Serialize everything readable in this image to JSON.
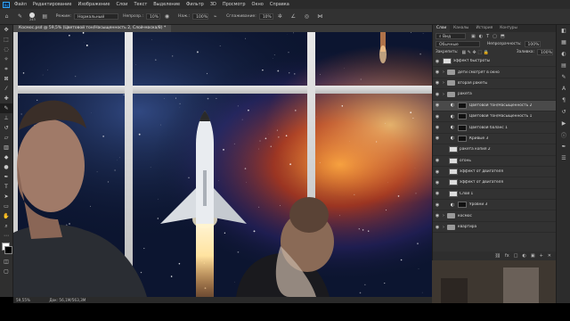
{
  "menu": {
    "logo": "Ps",
    "items": [
      "Файл",
      "Редактирование",
      "Изображение",
      "Слои",
      "Текст",
      "Выделение",
      "Фильтр",
      "3D",
      "Просмотр",
      "Окно",
      "Справка"
    ]
  },
  "options": {
    "brush_size": "243",
    "mode_label": "Режим:",
    "mode_value": "Нормальный",
    "opacity_label": "Непрозр.:",
    "opacity_value": "10%",
    "flow_label": "Наж.:",
    "flow_value": "100%",
    "smoothing_label": "Сглаживание:",
    "smoothing_value": "10%"
  },
  "document": {
    "tab_title": "Космос.psd @ 59,5% (Цветовой тон/Насыщенность 2, Слой-маска/8) *",
    "zoom": "59,55%",
    "doc_info": "Док: 56,1М/563,3М"
  },
  "panel": {
    "tabs": [
      "Слои",
      "Каналы",
      "История",
      "Контуры"
    ],
    "active_tab": "Слои",
    "filter_label": "Вид",
    "blend_mode": "Обычные",
    "opacity_label": "Непрозрачность:",
    "opacity_value": "100%",
    "lock_label": "Закрепить:",
    "fill_label": "Заливка:",
    "fill_value": "100%"
  },
  "layers": [
    {
      "name": "эффект быстроты",
      "type": "thumb",
      "visible": true,
      "selected": false,
      "indent": 0
    },
    {
      "name": "дети смотрят в окно",
      "type": "folder",
      "visible": true,
      "selected": false,
      "indent": 0
    },
    {
      "name": "вторая ракеты",
      "type": "folder",
      "visible": true,
      "selected": false,
      "indent": 0
    },
    {
      "name": "ракета",
      "type": "folder",
      "visible": true,
      "selected": false,
      "indent": 0
    },
    {
      "name": "Цветовой тон/Насыщенность 2",
      "type": "adjust",
      "visible": true,
      "selected": true,
      "indent": 1
    },
    {
      "name": "Цветовой тон/Насыщенность 1",
      "type": "adjust",
      "visible": true,
      "selected": false,
      "indent": 1
    },
    {
      "name": "Цветовой баланс 1",
      "type": "adjust",
      "visible": true,
      "selected": false,
      "indent": 1
    },
    {
      "name": "Кривые 3",
      "type": "adjust",
      "visible": true,
      "selected": false,
      "indent": 1
    },
    {
      "name": "ракета копия 2",
      "type": "thumb",
      "visible": false,
      "selected": false,
      "indent": 1
    },
    {
      "name": "огонь",
      "type": "thumb",
      "visible": true,
      "selected": false,
      "indent": 1
    },
    {
      "name": "эффект от двигателя",
      "type": "thumb",
      "visible": true,
      "selected": false,
      "indent": 1
    },
    {
      "name": "эффект от двигателя",
      "type": "thumb",
      "visible": true,
      "selected": false,
      "indent": 1
    },
    {
      "name": "Слой 1",
      "type": "thumb",
      "visible": true,
      "selected": false,
      "indent": 1
    },
    {
      "name": "Уровни 3",
      "type": "adjust",
      "visible": true,
      "selected": false,
      "indent": 1
    },
    {
      "name": "космос",
      "type": "folder",
      "visible": true,
      "selected": false,
      "indent": 0
    },
    {
      "name": "квартира",
      "type": "folder",
      "visible": true,
      "selected": false,
      "indent": 0
    }
  ],
  "footer_icons": [
    "fx",
    "◐",
    "□",
    "▣",
    "+",
    "🗑"
  ]
}
